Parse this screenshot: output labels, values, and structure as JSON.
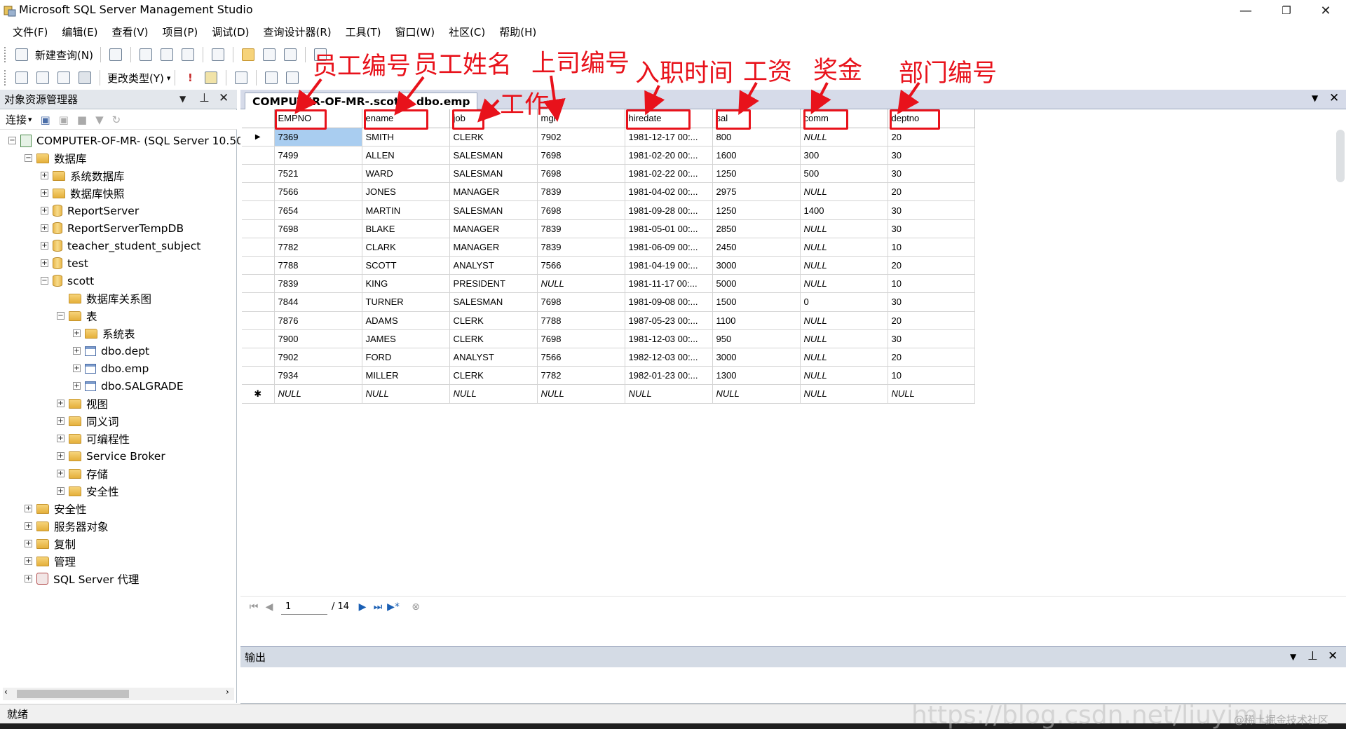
{
  "window": {
    "title": "Microsoft SQL Server Management Studio",
    "controls": {
      "minimize": "—",
      "restore": "❐",
      "close": "✕"
    }
  },
  "menu": {
    "items": [
      "文件(F)",
      "编辑(E)",
      "查看(V)",
      "项目(P)",
      "调试(D)",
      "查询设计器(R)",
      "工具(T)",
      "窗口(W)",
      "社区(C)",
      "帮助(H)"
    ]
  },
  "toolbar1": {
    "new_query": "新建查询(N)"
  },
  "toolbar2": {
    "change_type": "更改类型(Y)"
  },
  "object_explorer": {
    "title": "对象资源管理器",
    "connect": "连接",
    "tree": [
      {
        "label": "COMPUTER-OF-MR- (SQL Server 10.50",
        "icon": "server-icon",
        "expander": "⊟"
      },
      {
        "label": "数据库",
        "icon": "folder-icon",
        "expander": "⊟"
      },
      {
        "label": "系统数据库",
        "icon": "folder-icon",
        "expander": "⊞"
      },
      {
        "label": "数据库快照",
        "icon": "folder-icon",
        "expander": "⊞"
      },
      {
        "label": "ReportServer",
        "icon": "database-icon",
        "expander": "⊞"
      },
      {
        "label": "ReportServerTempDB",
        "icon": "database-icon",
        "expander": "⊞"
      },
      {
        "label": "teacher_student_subject",
        "icon": "database-icon",
        "expander": "⊞"
      },
      {
        "label": "test",
        "icon": "database-icon",
        "expander": "⊞"
      },
      {
        "label": "scott",
        "icon": "database-icon",
        "expander": "⊟"
      },
      {
        "label": "数据库关系图",
        "icon": "folder-icon",
        "expander": ""
      },
      {
        "label": "表",
        "icon": "folder-icon",
        "expander": "⊟"
      },
      {
        "label": "系统表",
        "icon": "folder-icon",
        "expander": "⊞"
      },
      {
        "label": "dbo.dept",
        "icon": "table-icon",
        "expander": "⊞"
      },
      {
        "label": "dbo.emp",
        "icon": "table-icon",
        "expander": "⊞"
      },
      {
        "label": "dbo.SALGRADE",
        "icon": "table-icon",
        "expander": "⊞"
      },
      {
        "label": "视图",
        "icon": "folder-icon",
        "expander": "⊞"
      },
      {
        "label": "同义词",
        "icon": "folder-icon",
        "expander": "⊞"
      },
      {
        "label": "可编程性",
        "icon": "folder-icon",
        "expander": "⊞"
      },
      {
        "label": "Service Broker",
        "icon": "folder-icon",
        "expander": "⊞"
      },
      {
        "label": "存储",
        "icon": "folder-icon",
        "expander": "⊞"
      },
      {
        "label": "安全性",
        "icon": "folder-icon",
        "expander": "⊞"
      },
      {
        "label": "安全性",
        "icon": "folder-icon",
        "expander": "⊞"
      },
      {
        "label": "服务器对象",
        "icon": "folder-icon",
        "expander": "⊞"
      },
      {
        "label": "复制",
        "icon": "folder-icon",
        "expander": "⊞"
      },
      {
        "label": "管理",
        "icon": "folder-icon",
        "expander": "⊞"
      },
      {
        "label": "SQL Server 代理",
        "icon": "agent-icon",
        "expander": "⊞"
      }
    ]
  },
  "document": {
    "tab_title": "COMPUTER-OF-MR-.scott - dbo.emp",
    "columns": [
      "EMPNO",
      "ename",
      "job",
      "mgr",
      "hiredate",
      "sal",
      "comm",
      "deptno"
    ],
    "rows": [
      [
        "7369",
        "SMITH",
        "CLERK",
        "7902",
        "1981-12-17 00:...",
        "800",
        "NULL",
        "20"
      ],
      [
        "7499",
        "ALLEN",
        "SALESMAN",
        "7698",
        "1981-02-20 00:...",
        "1600",
        "300",
        "30"
      ],
      [
        "7521",
        "WARD",
        "SALESMAN",
        "7698",
        "1981-02-22 00:...",
        "1250",
        "500",
        "30"
      ],
      [
        "7566",
        "JONES",
        "MANAGER",
        "7839",
        "1981-04-02 00:...",
        "2975",
        "NULL",
        "20"
      ],
      [
        "7654",
        "MARTIN",
        "SALESMAN",
        "7698",
        "1981-09-28 00:...",
        "1250",
        "1400",
        "30"
      ],
      [
        "7698",
        "BLAKE",
        "MANAGER",
        "7839",
        "1981-05-01 00:...",
        "2850",
        "NULL",
        "30"
      ],
      [
        "7782",
        "CLARK",
        "MANAGER",
        "7839",
        "1981-06-09 00:...",
        "2450",
        "NULL",
        "10"
      ],
      [
        "7788",
        "SCOTT",
        "ANALYST",
        "7566",
        "1981-04-19 00:...",
        "3000",
        "NULL",
        "20"
      ],
      [
        "7839",
        "KING",
        "PRESIDENT",
        "NULL",
        "1981-11-17 00:...",
        "5000",
        "NULL",
        "10"
      ],
      [
        "7844",
        "TURNER",
        "SALESMAN",
        "7698",
        "1981-09-08 00:...",
        "1500",
        "0",
        "30"
      ],
      [
        "7876",
        "ADAMS",
        "CLERK",
        "7788",
        "1987-05-23 00:...",
        "1100",
        "NULL",
        "20"
      ],
      [
        "7900",
        "JAMES",
        "CLERK",
        "7698",
        "1981-12-03 00:...",
        "950",
        "NULL",
        "30"
      ],
      [
        "7902",
        "FORD",
        "ANALYST",
        "7566",
        "1982-12-03 00:...",
        "3000",
        "NULL",
        "20"
      ],
      [
        "7934",
        "MILLER",
        "CLERK",
        "7782",
        "1982-01-23 00:...",
        "1300",
        "NULL",
        "10"
      ],
      [
        "NULL",
        "NULL",
        "NULL",
        "NULL",
        "NULL",
        "NULL",
        "NULL",
        "NULL"
      ]
    ],
    "row_markers": {
      "current": "▶",
      "new": "✱"
    },
    "pager": {
      "current_page": "1",
      "total": "/ 14"
    }
  },
  "output": {
    "title": "输出"
  },
  "statusbar": {
    "text": "就绪"
  },
  "annotations": {
    "empno": "员工编号",
    "ename": "员工姓名",
    "job": "工作",
    "mgr": "上司编号",
    "hiredate": "入职时间",
    "sal": "工资",
    "comm": "奖金",
    "deptno": "部门编号",
    "color": "#e8121b"
  },
  "watermark": {
    "url": "https://blog.csdn.net/liuyimu",
    "site": "@稀土掘金技术社区"
  }
}
